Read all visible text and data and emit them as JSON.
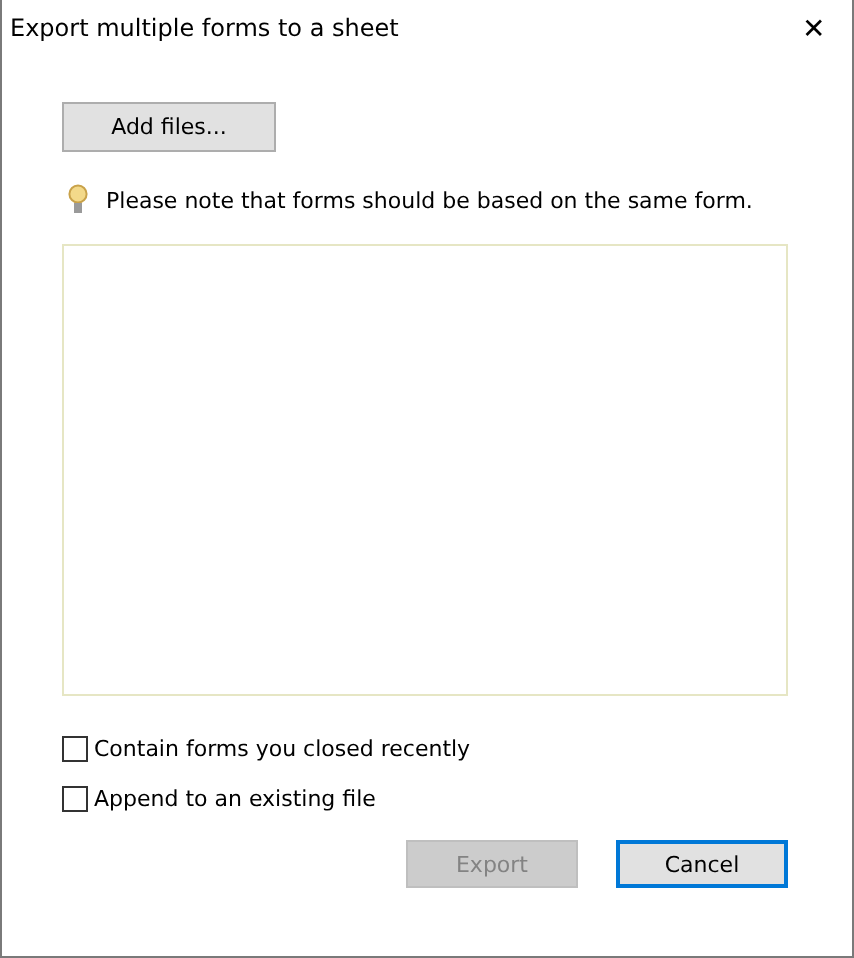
{
  "window": {
    "title": "Export multiple forms to a sheet",
    "close": "✕"
  },
  "add_button": {
    "label": "Add files..."
  },
  "note": "Please note that forms should be based on the same form.",
  "options": [
    {
      "label": "Contain forms you closed recently",
      "checked": false
    },
    {
      "label": "Append to an existing file",
      "checked": false
    }
  ],
  "buttons": [
    {
      "label": "Export",
      "disabled": true,
      "default": false
    },
    {
      "label": "Cancel",
      "disabled": false,
      "default": true
    }
  ]
}
